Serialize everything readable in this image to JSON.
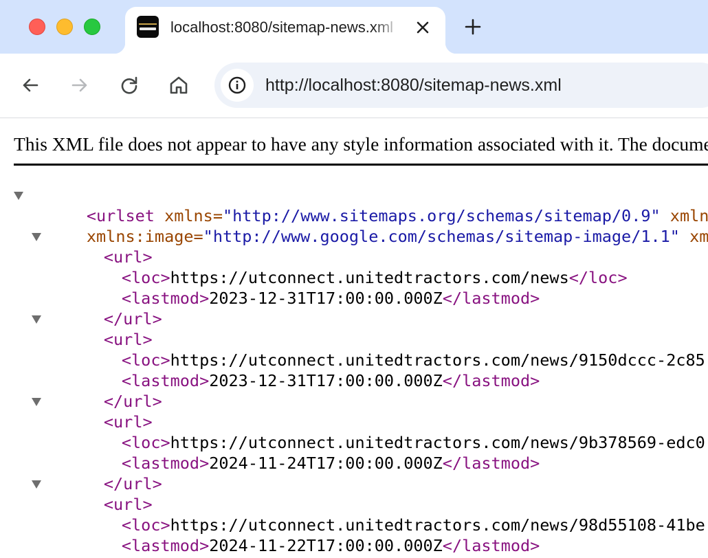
{
  "browser": {
    "tab": {
      "title": "localhost:8080/sitemap-news.xml",
      "favicon": "united-tractors-connect-logo"
    },
    "address_bar": {
      "url": "http://localhost:8080/sitemap-news.xml",
      "site_info_icon": "info-circle-icon"
    },
    "nav": {
      "back_icon": "arrow-left-icon",
      "forward_icon": "arrow-right-icon",
      "reload_icon": "reload-icon",
      "home_icon": "home-icon"
    }
  },
  "page": {
    "info_text": "This XML file does not appear to have any style information associated with it. The document tree is shown below.",
    "xml": {
      "urlset_open": "<urlset",
      "xmlns_attr": " xmlns=",
      "xmlns_value": "\"http://www.sitemaps.org/schemas/sitemap/0.9\"",
      "xmlns_news_attr": " xmlns:news=",
      "xmlns_image_attr": "xmlns:image=",
      "xmlns_image_value": "\"http://www.google.com/schemas/sitemap-image/1.1\"",
      "xmlns_xhtml_attr": " xmlns:xhtml=",
      "urls": [
        {
          "loc": "https://utconnect.unitedtractors.com/news",
          "lastmod": "2023-12-31T17:00:00.000Z"
        },
        {
          "loc": "https://utconnect.unitedtractors.com/news/9150dccc-2c85",
          "lastmod": "2023-12-31T17:00:00.000Z"
        },
        {
          "loc": "https://utconnect.unitedtractors.com/news/9b378569-edc0",
          "lastmod": "2024-11-24T17:00:00.000Z"
        },
        {
          "loc": "https://utconnect.unitedtractors.com/news/98d55108-41be",
          "lastmod": "2024-11-22T17:00:00.000Z"
        }
      ]
    }
  },
  "colors": {
    "tab_strip": "#d3e3fd",
    "omnibox": "#eef2f9",
    "xml_tag": "#881280",
    "xml_attribute": "#994500",
    "xml_value": "#1a1aa6"
  }
}
